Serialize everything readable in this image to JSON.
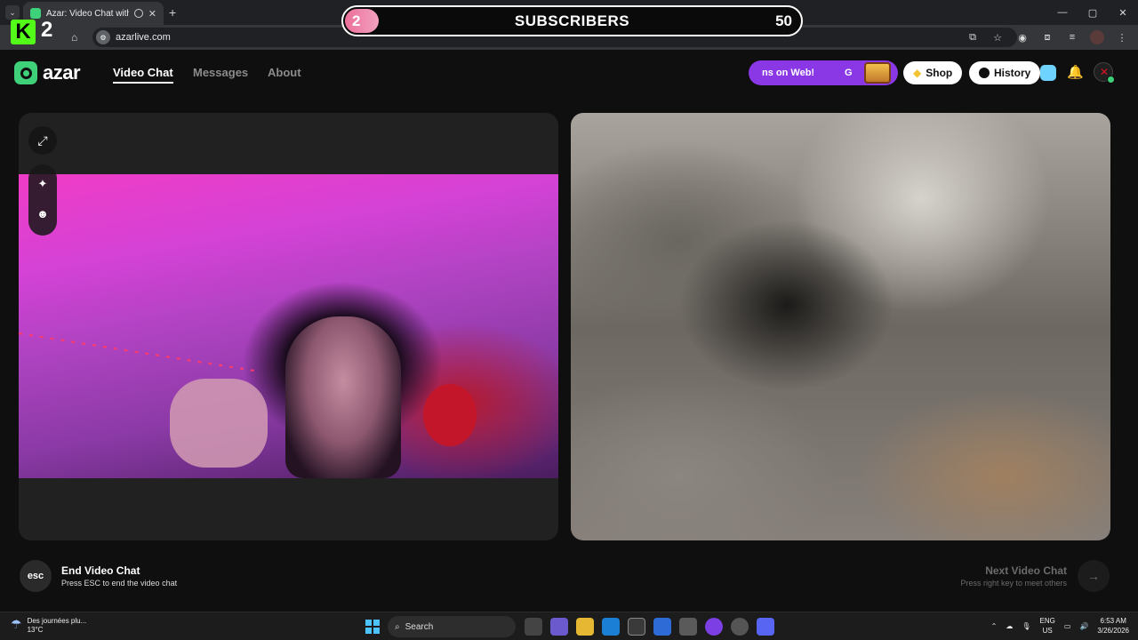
{
  "browser": {
    "tab_title": "Azar: Video Chat with New",
    "url": "azarlive.com",
    "window_controls": [
      "—",
      "▢",
      "✕"
    ]
  },
  "overlay": {
    "kick_count": "2",
    "subs_current": "2",
    "subs_label": "SUBSCRIBERS",
    "subs_goal": "50",
    "subs_progress": 0.04
  },
  "appnav": {
    "logo_text": "azar",
    "links": [
      "Video Chat",
      "Messages",
      "About"
    ],
    "promo_text": "ns on Web!",
    "promo_g": "G",
    "shop_label": "Shop",
    "history_label": "History"
  },
  "controls": {
    "esc_key": "esc",
    "end_title": "End Video Chat",
    "end_sub": "Press ESC to end the video chat",
    "next_title": "Next Video Chat",
    "next_sub": "Press right key to meet others",
    "next_arrow": "→"
  },
  "taskbar": {
    "weather_text": "Des journées plu...",
    "temperature": "13°C",
    "search_label": "Search",
    "lang": "ENG",
    "region": "US",
    "time": "6:53 AM",
    "date": "3/26/2026"
  },
  "colors": {
    "accent": "#3fd17a",
    "promo": "#8a37e6",
    "kick": "#53fc18",
    "subbar_fill": "#ec6f9a"
  }
}
